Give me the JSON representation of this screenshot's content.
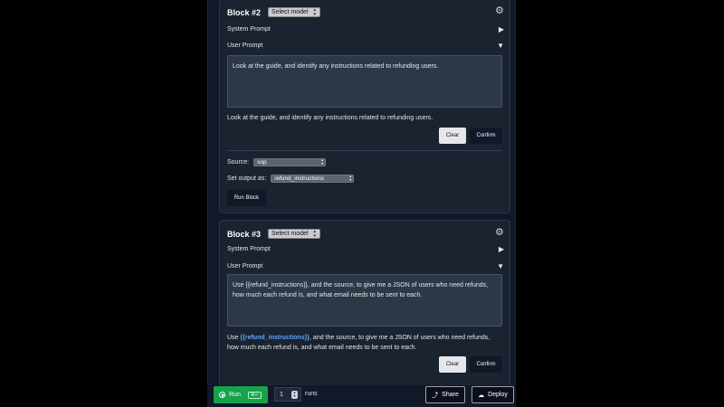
{
  "block2": {
    "title": "Block #2",
    "model_select": "Select model",
    "system_prompt": "System Prompt",
    "user_prompt": "User Prompt",
    "textarea": "Look at the guide, and identify any instructions related to refunding users.",
    "preview": "Look at the guide, and identify any instructions related to refunding users.",
    "clear": "Clear",
    "confirm": "Confirm",
    "source_label": "Source:",
    "source_value": "sop",
    "output_label": "Set output as:",
    "output_value": "refund_instructions",
    "run_block": "Run Block"
  },
  "block3": {
    "title": "Block #3",
    "model_select": "Select model",
    "system_prompt": "System Prompt",
    "user_prompt": "User Prompt",
    "textarea": "Use {{refund_instructions}}, and the source, to give me a JSON of users who need refunds, how much each refund is, and what email needs to be sent to each.",
    "preview_pre": "Use ",
    "preview_var": "{{refund_instructions}}",
    "preview_post": ", and the source, to give me a JSON of users who need refunds, how much each refund is, and what email needs to be sent to each.",
    "clear": "Clear",
    "confirm": "Confirm"
  },
  "footer": {
    "run": "Run",
    "run_shortcut": "⌘↵",
    "runs_value": "1",
    "runs_label": "runs",
    "share": "Share",
    "deploy": "Deploy"
  }
}
